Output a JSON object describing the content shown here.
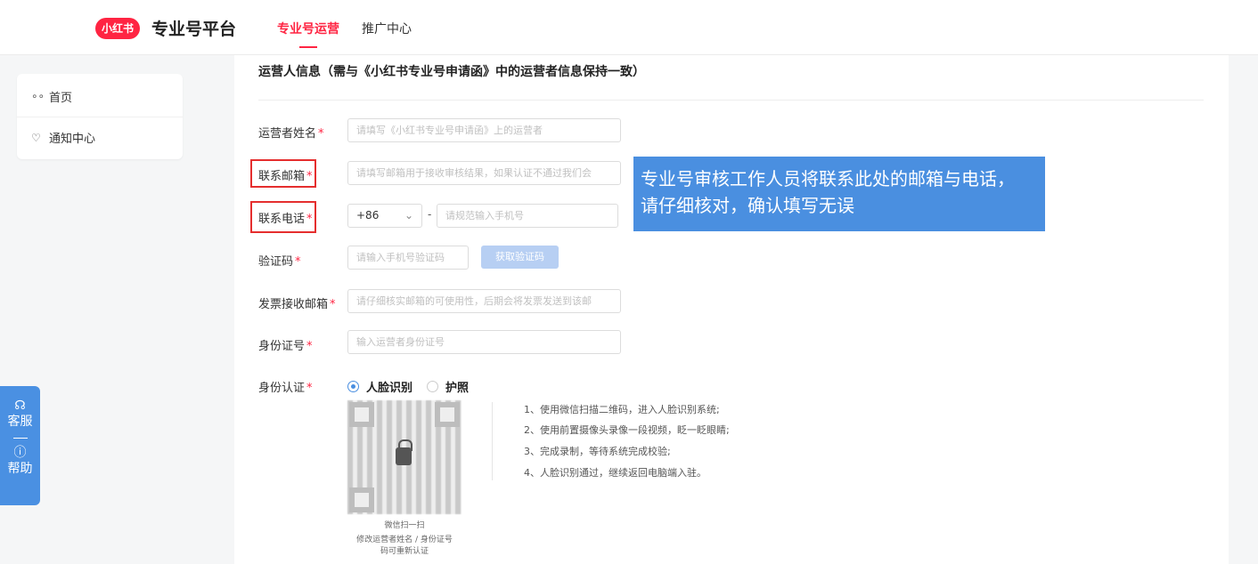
{
  "header": {
    "logo_text": "小红书",
    "platform_title": "专业号平台",
    "tabs": [
      {
        "label": "专业号运营",
        "active": true
      },
      {
        "label": "推广中心",
        "active": false
      }
    ]
  },
  "sidebar": {
    "items": [
      {
        "icon": "grid-icon",
        "label": "首页"
      },
      {
        "icon": "bell-icon",
        "label": "通知中心"
      }
    ]
  },
  "float_service": {
    "service_label": "客服",
    "help_label": "帮助"
  },
  "form": {
    "section_title": "运营人信息（需与《小红书专业号申请函》中的运营者信息保持一致）",
    "required_mark": "*",
    "fields": {
      "operator_name": {
        "label": "运营者姓名",
        "placeholder": "请填写《小红书专业号申请函》上的运营者"
      },
      "email": {
        "label": "联系邮箱",
        "placeholder": "请填写邮箱用于接收审核结果，如果认证不通过我们会"
      },
      "phone": {
        "label": "联系电话",
        "country_code": "+86",
        "separator": "-",
        "placeholder": "请规范输入手机号"
      },
      "code": {
        "label": "验证码",
        "placeholder": "请输入手机号验证码",
        "button": "获取验证码"
      },
      "invoice_email": {
        "label": "发票接收邮箱",
        "placeholder": "请仔细核实邮箱的可使用性，后期会将发票发送到该邮"
      },
      "id_number": {
        "label": "身份证号",
        "placeholder": "输入运营者身份证号"
      },
      "id_verify": {
        "label": "身份认证",
        "options": [
          {
            "label": "人脸识别",
            "checked": true
          },
          {
            "label": "护照",
            "checked": false
          }
        ]
      }
    },
    "qr_caption_1": "微信扫一扫",
    "qr_caption_2": "修改运营者姓名 / 身份证号",
    "qr_caption_3": "码可重新认证",
    "steps": [
      "1、使用微信扫描二维码，进入人脸识别系统;",
      "2、使用前置摄像头录像一段视频，眨一眨眼睛;",
      "3、完成录制，等待系统完成校验;",
      "4、人脸识别通过，继续返回电脑端入驻。"
    ]
  },
  "annotation": {
    "line1": "专业号审核工作人员将联系此处的邮箱与电话，",
    "line2": "请仔细核对，确认填写无误"
  },
  "colors": {
    "brand": "#ff2442",
    "accent_blue": "#4a8fe0",
    "highlight_red": "#e52e2e"
  }
}
